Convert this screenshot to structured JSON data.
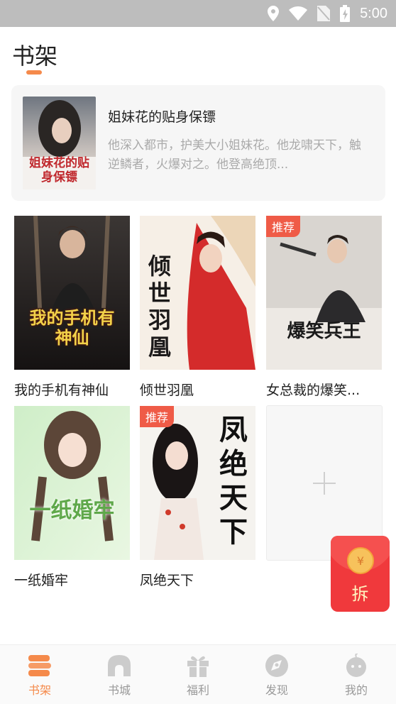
{
  "status_bar": {
    "time": "5:00"
  },
  "page": {
    "title": "书架"
  },
  "featured": {
    "title": "姐妹花的贴身保镖",
    "description": "他深入都市，护美大小姐妹花。他龙啸天下，触逆鳞者，火爆对之。他登高绝顶...",
    "cover_text": "姐妹花的贴身保镖"
  },
  "books": [
    {
      "title": "我的手机有神仙",
      "cover_text": "我的手机有神仙",
      "tag": ""
    },
    {
      "title": "倾世羽凰",
      "cover_text": "倾世羽凰",
      "tag": ""
    },
    {
      "title": "女总裁的爆笑...",
      "cover_text": "爆笑兵王",
      "tag": "推荐"
    },
    {
      "title": "一纸婚牢",
      "cover_text": "一纸婚牢",
      "tag": ""
    },
    {
      "title": "凤绝天下",
      "cover_text": "凤绝天下",
      "tag": "推荐"
    }
  ],
  "add_tile": {
    "icon": "plus-icon"
  },
  "red_packet": {
    "label": "拆",
    "coin": "¥"
  },
  "tabs": [
    {
      "label": "书架",
      "icon": "bookshelf-icon",
      "active": true
    },
    {
      "label": "书城",
      "icon": "store-icon",
      "active": false
    },
    {
      "label": "福利",
      "icon": "gift-icon",
      "active": false
    },
    {
      "label": "发现",
      "icon": "discover-icon",
      "active": false
    },
    {
      "label": "我的",
      "icon": "profile-icon",
      "active": false
    }
  ],
  "colors": {
    "accent": "#f58a4b",
    "tag": "#ef5b47",
    "red_packet": "#f0393c",
    "status_bar": "#bdbdbd"
  }
}
